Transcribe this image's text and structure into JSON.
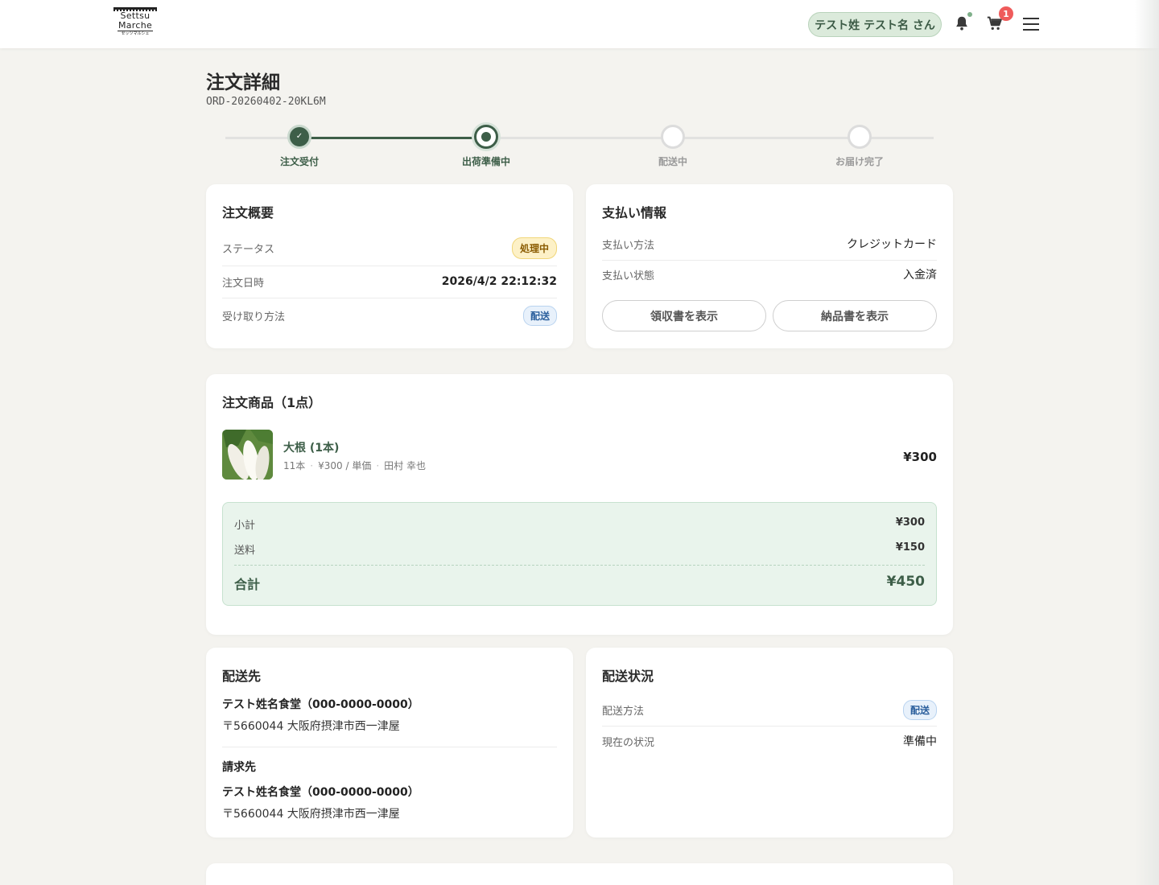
{
  "header": {
    "logo": {
      "line1": "Settsu",
      "line2": "Marche",
      "line3": "セッツマルシェ"
    },
    "user_greeting": "テスト姓 テスト名 さん",
    "cart_count": "1",
    "icons": {
      "notifications": "bell-icon",
      "cart": "cart-icon",
      "menu": "hamburger-menu-icon"
    }
  },
  "page": {
    "title": "注文詳細",
    "order_number": "ORD-20260402-20KL6M"
  },
  "progress": {
    "current_step": 2,
    "steps": [
      {
        "label": "注文受付",
        "state": "done"
      },
      {
        "label": "出荷準備中",
        "state": "current"
      },
      {
        "label": "配送中",
        "state": "pending"
      },
      {
        "label": "お届け完了",
        "state": "pending"
      }
    ]
  },
  "summary": {
    "title": "注文概要",
    "status_label": "ステータス",
    "status_value": "処理中",
    "date_label": "注文日時",
    "date_value": "2026/4/2 22:12:32",
    "receive_label": "受け取り方法",
    "receive_value": "配送"
  },
  "payment": {
    "title": "支払い情報",
    "method_label": "支払い方法",
    "method_value": "クレジットカード",
    "state_label": "支払い状態",
    "state_value": "入金済",
    "receipt_button": "領収書を表示",
    "invoice_button": "納品書を表示"
  },
  "items": {
    "title": "注文商品（1点）",
    "list": [
      {
        "name": "大根 (1本)",
        "quantity": "11本",
        "unit_price": "¥300 / 単価",
        "producer": "田村 幸也",
        "price": "¥300"
      }
    ],
    "subtotal_label": "小計",
    "subtotal": "¥300",
    "shipping_label": "送料",
    "shipping": "¥150",
    "total_label": "合計",
    "total": "¥450"
  },
  "shipping_address": {
    "title": "配送先",
    "name": "テスト姓名食堂（000-0000-0000）",
    "address": "〒5660044 大阪府摂津市西一津屋",
    "billing_title": "請求先",
    "billing_name": "テスト姓名食堂（000-0000-0000）",
    "billing_address": "〒5660044 大阪府摂津市西一津屋"
  },
  "delivery": {
    "title": "配送状況",
    "method_label": "配送方法",
    "method_value": "配送",
    "status_label": "現在の状況",
    "status_value": "準備中"
  },
  "colors": {
    "brand": "#3d5e48",
    "background": "#f4f3ef",
    "summary_bg": "#e9f4ec",
    "badge": "#ef5b5b"
  }
}
